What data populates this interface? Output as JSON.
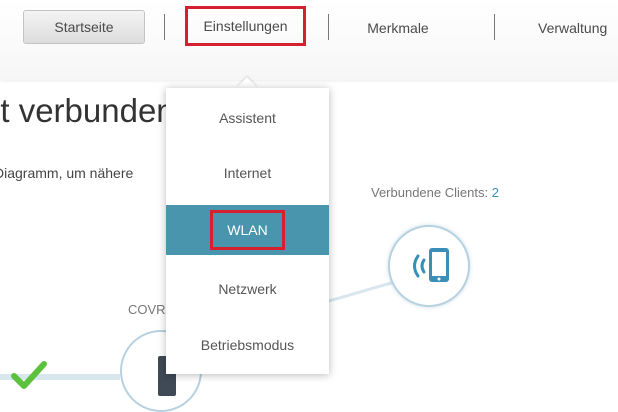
{
  "nav": {
    "home": "Startseite",
    "settings": "Einstellungen",
    "features": "Merkmale",
    "admin": "Verwaltung"
  },
  "main": {
    "title": "et verbunden",
    "subtitle": "Diagramm, um nähere"
  },
  "clients": {
    "label": "Verbundene Clients:",
    "count": "2"
  },
  "device": {
    "label": "COVR"
  },
  "dropdown": {
    "items": [
      {
        "label": "Assistent"
      },
      {
        "label": "Internet"
      },
      {
        "label": "WLAN"
      },
      {
        "label": "Netzwerk"
      },
      {
        "label": "Betriebsmodus"
      }
    ]
  },
  "colors": {
    "accent": "#4a95ae",
    "highlight": "#d4202f",
    "link": "#3a8fb7"
  },
  "icons": [
    "wireless-device-icon",
    "router-icon",
    "check-icon"
  ]
}
